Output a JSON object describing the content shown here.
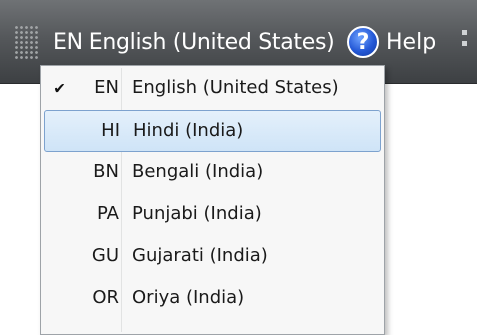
{
  "langbar": {
    "current_code": "EN",
    "current_name": "English (United States)",
    "help_label": "Help",
    "help_glyph": "?"
  },
  "menu": {
    "items": [
      {
        "code": "EN",
        "name": "English (United States)",
        "checked": true,
        "highlighted": false
      },
      {
        "code": "HI",
        "name": "Hindi (India)",
        "checked": false,
        "highlighted": true
      },
      {
        "code": "BN",
        "name": "Bengali (India)",
        "checked": false,
        "highlighted": false
      },
      {
        "code": "PA",
        "name": "Punjabi (India)",
        "checked": false,
        "highlighted": false
      },
      {
        "code": "GU",
        "name": "Gujarati (India)",
        "checked": false,
        "highlighted": false
      },
      {
        "code": "OR",
        "name": "Oriya (India)",
        "checked": false,
        "highlighted": false
      }
    ],
    "check_glyph": "✔"
  },
  "colors": {
    "highlight_fill": "#cfe4f7",
    "highlight_border": "#7da2ce",
    "bar_top": "#6f7275",
    "bar_bottom": "#3d4043"
  }
}
